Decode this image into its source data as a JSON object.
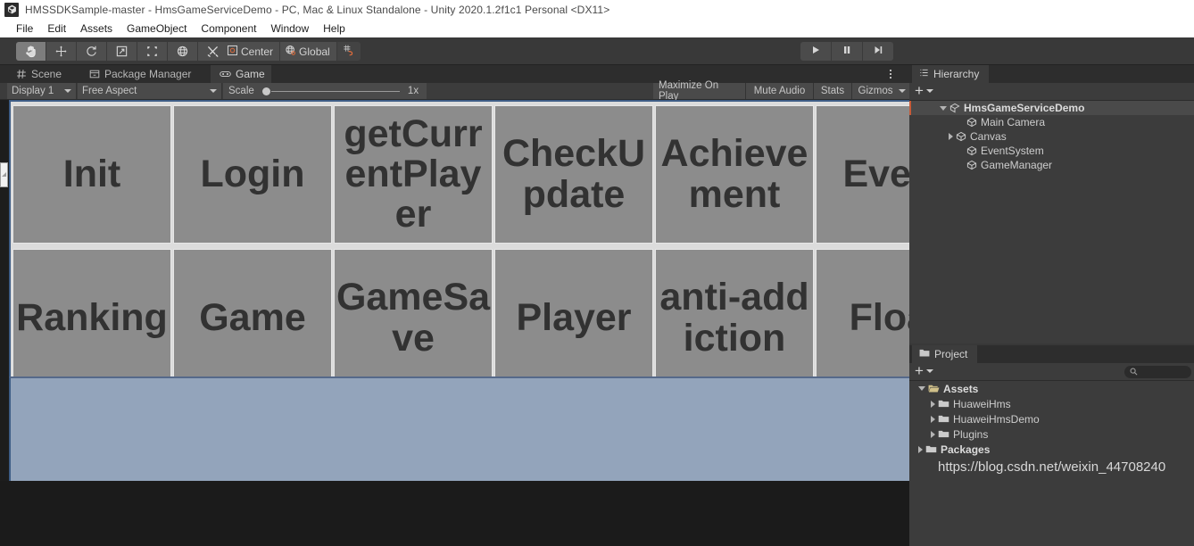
{
  "window": {
    "icon": "unity-logo-icon",
    "title": "HMSSDKSample-master - HmsGameServiceDemo - PC, Mac & Linux Standalone - Unity 2020.1.2f1c1 Personal <DX11>"
  },
  "menubar": {
    "items": [
      {
        "label": "File"
      },
      {
        "label": "Edit"
      },
      {
        "label": "Assets"
      },
      {
        "label": "GameObject"
      },
      {
        "label": "Component"
      },
      {
        "label": "Window"
      },
      {
        "label": "Help"
      }
    ]
  },
  "toolbar": {
    "transform_tools": [
      {
        "name": "hand-tool",
        "icon": "hand-icon",
        "active": true
      },
      {
        "name": "move-tool",
        "icon": "move-arrows-icon",
        "active": false
      },
      {
        "name": "rotate-tool",
        "icon": "rotate-icon",
        "active": false
      },
      {
        "name": "scale-tool",
        "icon": "scale-icon",
        "active": false
      },
      {
        "name": "rect-tool",
        "icon": "rect-transform-icon",
        "active": false
      },
      {
        "name": "transform-tool",
        "icon": "transform-globe-icon",
        "active": false
      },
      {
        "name": "custom-tool",
        "icon": "wrench-screwdriver-icon",
        "active": false
      }
    ],
    "pivot_label": "Center",
    "pivot_icon": "pivot-center-icon",
    "handle_label": "Global",
    "handle_icon": "globe-icon",
    "snap_icon": "grid-snap-icon",
    "play_controls": [
      {
        "name": "play-button",
        "icon": "play-icon"
      },
      {
        "name": "pause-button",
        "icon": "pause-icon"
      },
      {
        "name": "step-button",
        "icon": "step-icon"
      }
    ]
  },
  "left_dock": {
    "tabs": [
      {
        "label": "Scene",
        "icon": "scene-grid-icon",
        "active": false
      },
      {
        "label": "Package Manager",
        "icon": "package-box-icon",
        "active": false
      },
      {
        "label": "Game",
        "icon": "gamepad-icon",
        "active": true
      }
    ],
    "kebab": "more-options-icon"
  },
  "game_toolbar": {
    "display": "Display 1",
    "aspect": "Free Aspect",
    "scale_label": "Scale",
    "scale_value": "1x",
    "right_buttons": [
      {
        "label": "Maximize On Play"
      },
      {
        "label": "Mute Audio"
      },
      {
        "label": "Stats"
      },
      {
        "label": "Gizmos"
      }
    ],
    "gizmos_caret": "chevron-down-icon"
  },
  "game_view": {
    "background_top": "#dcdcdc",
    "background_bottom": "#93a4bb",
    "button_fill": "#8c8c8c",
    "button_text_color": "#323232",
    "buttons": [
      {
        "label": "Init",
        "row": 0,
        "col": 0
      },
      {
        "label": "Login",
        "row": 0,
        "col": 1
      },
      {
        "label": "getCurrentPlayer",
        "row": 0,
        "col": 2
      },
      {
        "label": "CheckUpdate",
        "row": 0,
        "col": 3
      },
      {
        "label": "Achievement",
        "row": 0,
        "col": 4
      },
      {
        "label": "Event",
        "row": 0,
        "col": 5
      },
      {
        "label": "Ranking",
        "row": 1,
        "col": 0
      },
      {
        "label": "Game",
        "row": 1,
        "col": 1
      },
      {
        "label": "GameSave",
        "row": 1,
        "col": 2
      },
      {
        "label": "Player",
        "row": 1,
        "col": 3
      },
      {
        "label": "anti-addiction",
        "row": 1,
        "col": 4
      },
      {
        "label": "Float",
        "row": 1,
        "col": 5
      }
    ]
  },
  "hierarchy": {
    "tab_label": "Hierarchy",
    "tab_icon": "hierarchy-list-icon",
    "create_label": "+",
    "items": [
      {
        "label": "HmsGameServiceDemo",
        "icon": "scene-icon",
        "depth": 0,
        "expanded": true,
        "selected": true,
        "bold": true
      },
      {
        "label": "Main Camera",
        "icon": "gameobject-icon",
        "depth": 1,
        "expanded": null,
        "selected": false,
        "bold": false
      },
      {
        "label": "Canvas",
        "icon": "gameobject-icon",
        "depth": 1,
        "expanded": false,
        "selected": false,
        "bold": false
      },
      {
        "label": "EventSystem",
        "icon": "gameobject-icon",
        "depth": 1,
        "expanded": null,
        "selected": false,
        "bold": false
      },
      {
        "label": "GameManager",
        "icon": "gameobject-icon",
        "depth": 1,
        "expanded": null,
        "selected": false,
        "bold": false
      }
    ]
  },
  "project": {
    "tab_label": "Project",
    "tab_icon": "folder-icon",
    "create_label": "+",
    "search_placeholder": "",
    "search_value": "",
    "search_icon": "search-icon",
    "items": [
      {
        "label": "Assets",
        "icon": "folder-open-icon",
        "depth": 0,
        "expanded": true,
        "bold": true
      },
      {
        "label": "HuaweiHms",
        "icon": "folder-icon",
        "depth": 1,
        "expanded": false,
        "bold": false
      },
      {
        "label": "HuaweiHmsDemo",
        "icon": "folder-icon",
        "depth": 1,
        "expanded": false,
        "bold": false
      },
      {
        "label": "Plugins",
        "icon": "folder-icon",
        "depth": 1,
        "expanded": false,
        "bold": false
      },
      {
        "label": "Packages",
        "icon": "folder-icon",
        "depth": 0,
        "expanded": false,
        "bold": true
      }
    ],
    "watermark": "https://blog.csdn.net/weixin_44708240"
  }
}
